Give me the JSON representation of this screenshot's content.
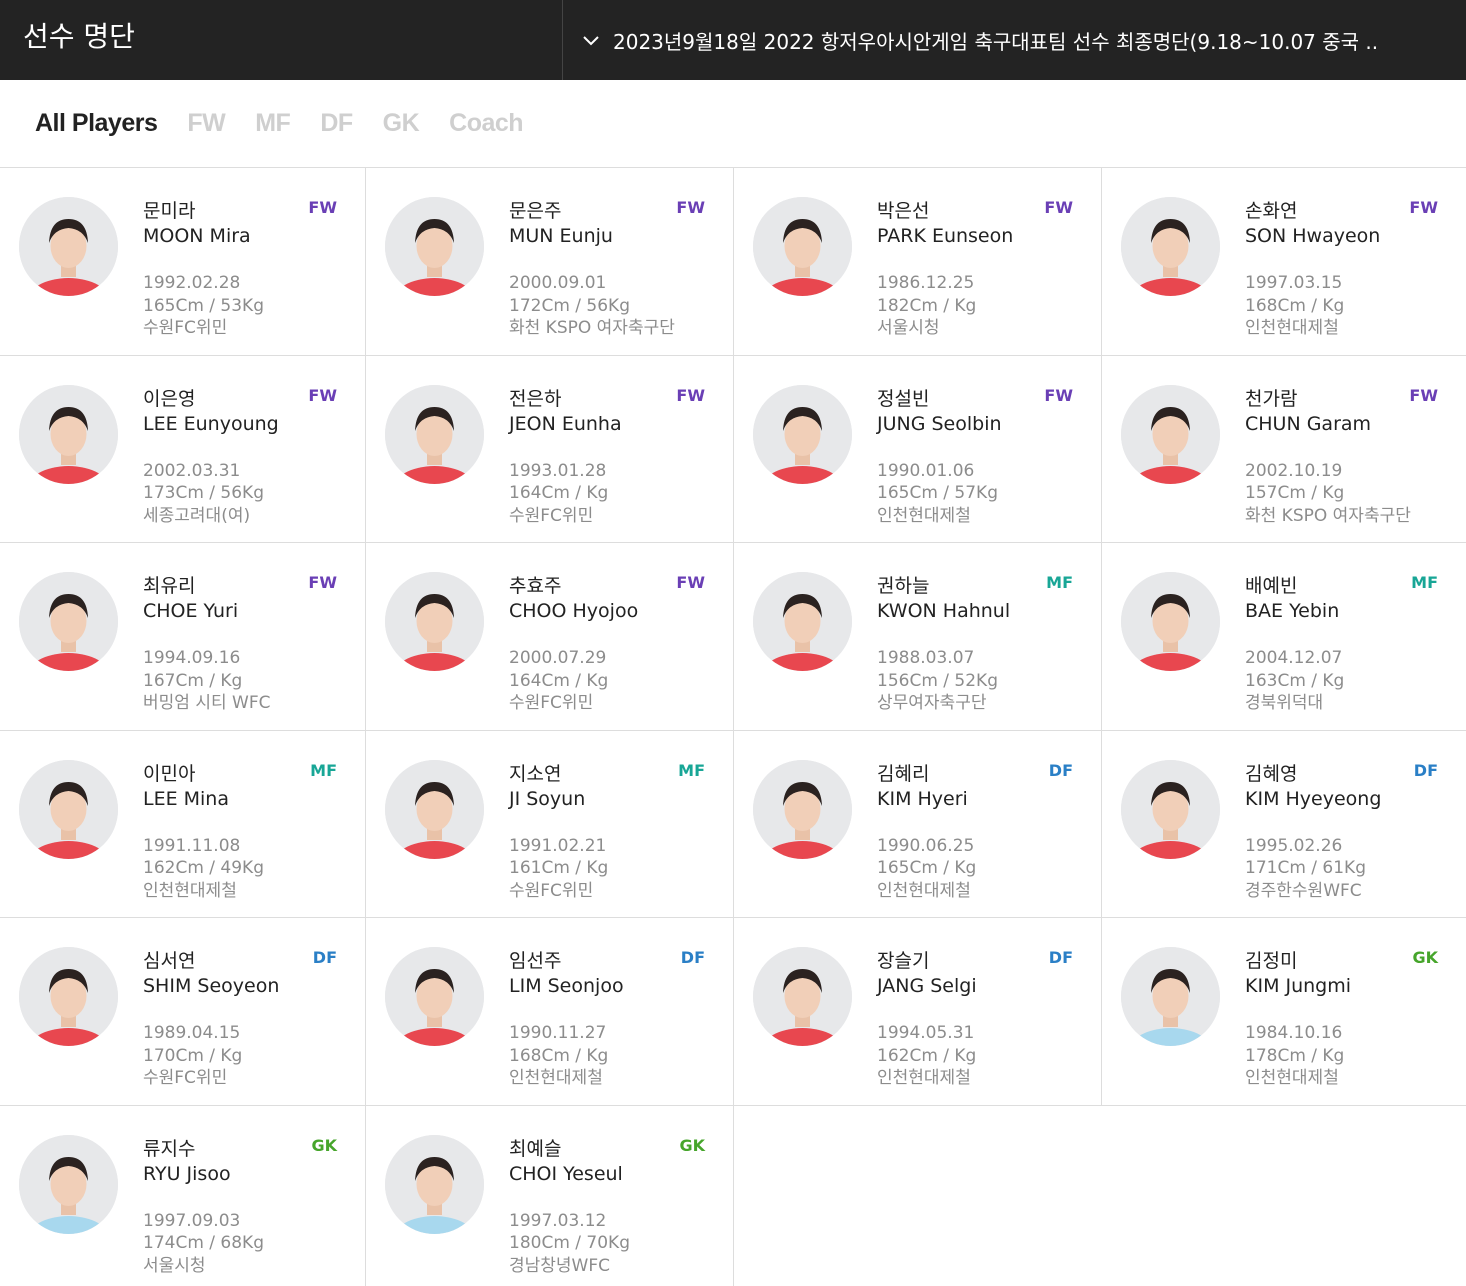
{
  "header": {
    "title": "선수 명단",
    "selector_text": "2023년9월18일 2022 항저우아시안게임 축구대표팀 선수 최종명단(9.18~10.07 중국 ..",
    "selector_icon": "chevron-down-icon"
  },
  "tabs": [
    {
      "label": "All Players",
      "active": true
    },
    {
      "label": "FW",
      "active": false
    },
    {
      "label": "MF",
      "active": false
    },
    {
      "label": "DF",
      "active": false
    },
    {
      "label": "GK",
      "active": false
    },
    {
      "label": "Coach",
      "active": false
    }
  ],
  "colors": {
    "FW": "#6a3fb5",
    "MF": "#18a696",
    "DF": "#2a7fc6",
    "GK": "#46a52b",
    "header_bg": "#232323"
  },
  "players": [
    {
      "name_ko": "문미라",
      "name_en": "MOON Mira",
      "pos": "FW",
      "birth": "1992.02.28",
      "body": "165Cm / 53Kg",
      "club": "수원FC위민"
    },
    {
      "name_ko": "문은주",
      "name_en": "MUN Eunju",
      "pos": "FW",
      "birth": "2000.09.01",
      "body": "172Cm / 56Kg",
      "club": "화천 KSPO 여자축구단"
    },
    {
      "name_ko": "박은선",
      "name_en": "PARK Eunseon",
      "pos": "FW",
      "birth": "1986.12.25",
      "body": "182Cm / Kg",
      "club": "서울시청"
    },
    {
      "name_ko": "손화연",
      "name_en": "SON Hwayeon",
      "pos": "FW",
      "birth": "1997.03.15",
      "body": "168Cm / Kg",
      "club": "인천현대제철"
    },
    {
      "name_ko": "이은영",
      "name_en": "LEE Eunyoung",
      "pos": "FW",
      "birth": "2002.03.31",
      "body": "173Cm / 56Kg",
      "club": "세종고려대(여)"
    },
    {
      "name_ko": "전은하",
      "name_en": "JEON Eunha",
      "pos": "FW",
      "birth": "1993.01.28",
      "body": "164Cm / Kg",
      "club": "수원FC위민"
    },
    {
      "name_ko": "정설빈",
      "name_en": "JUNG Seolbin",
      "pos": "FW",
      "birth": "1990.01.06",
      "body": "165Cm / 57Kg",
      "club": "인천현대제철"
    },
    {
      "name_ko": "천가람",
      "name_en": "CHUN Garam",
      "pos": "FW",
      "birth": "2002.10.19",
      "body": "157Cm / Kg",
      "club": "화천 KSPO 여자축구단"
    },
    {
      "name_ko": "최유리",
      "name_en": "CHOE Yuri",
      "pos": "FW",
      "birth": "1994.09.16",
      "body": "167Cm / Kg",
      "club": "버밍엄 시티 WFC"
    },
    {
      "name_ko": "추효주",
      "name_en": "CHOO Hyojoo",
      "pos": "FW",
      "birth": "2000.07.29",
      "body": "164Cm / Kg",
      "club": "수원FC위민"
    },
    {
      "name_ko": "권하늘",
      "name_en": "KWON Hahnul",
      "pos": "MF",
      "birth": "1988.03.07",
      "body": "156Cm / 52Kg",
      "club": "상무여자축구단"
    },
    {
      "name_ko": "배예빈",
      "name_en": "BAE Yebin",
      "pos": "MF",
      "birth": "2004.12.07",
      "body": "163Cm / Kg",
      "club": "경북위덕대"
    },
    {
      "name_ko": "이민아",
      "name_en": "LEE Mina",
      "pos": "MF",
      "birth": "1991.11.08",
      "body": "162Cm / 49Kg",
      "club": "인천현대제철"
    },
    {
      "name_ko": "지소연",
      "name_en": "JI Soyun",
      "pos": "MF",
      "birth": "1991.02.21",
      "body": "161Cm / Kg",
      "club": "수원FC위민"
    },
    {
      "name_ko": "김혜리",
      "name_en": "KIM Hyeri",
      "pos": "DF",
      "birth": "1990.06.25",
      "body": "165Cm / Kg",
      "club": "인천현대제철"
    },
    {
      "name_ko": "김혜영",
      "name_en": "KIM Hyeyeong",
      "pos": "DF",
      "birth": "1995.02.26",
      "body": "171Cm / 61Kg",
      "club": "경주한수원WFC"
    },
    {
      "name_ko": "심서연",
      "name_en": "SHIM Seoyeon",
      "pos": "DF",
      "birth": "1989.04.15",
      "body": "170Cm / Kg",
      "club": "수원FC위민"
    },
    {
      "name_ko": "임선주",
      "name_en": "LIM Seonjoo",
      "pos": "DF",
      "birth": "1990.11.27",
      "body": "168Cm / Kg",
      "club": "인천현대제철"
    },
    {
      "name_ko": "장슬기",
      "name_en": "JANG Selgi",
      "pos": "DF",
      "birth": "1994.05.31",
      "body": "162Cm / Kg",
      "club": "인천현대제철"
    },
    {
      "name_ko": "김정미",
      "name_en": "KIM Jungmi",
      "pos": "GK",
      "birth": "1984.10.16",
      "body": "178Cm / Kg",
      "club": "인천현대제철"
    },
    {
      "name_ko": "류지수",
      "name_en": "RYU Jisoo",
      "pos": "GK",
      "birth": "1997.09.03",
      "body": "174Cm / 68Kg",
      "club": "서울시청"
    },
    {
      "name_ko": "최예슬",
      "name_en": "CHOI Yeseul",
      "pos": "GK",
      "birth": "1997.03.12",
      "body": "180Cm / 70Kg",
      "club": "경남창녕WFC"
    }
  ]
}
